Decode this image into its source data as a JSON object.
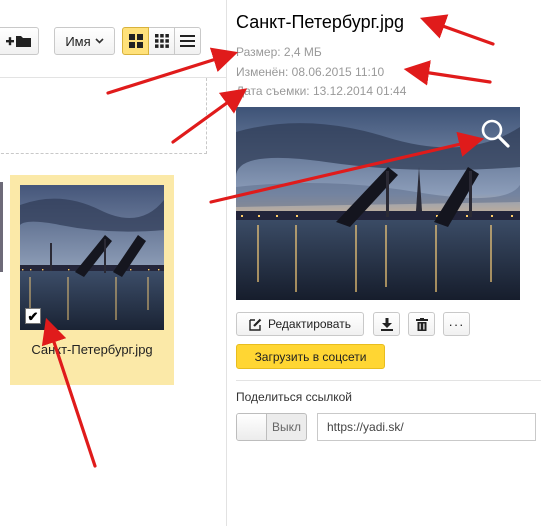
{
  "toolbar": {
    "new_folder_icon": "plus-folder-icon",
    "sort_label": "Имя",
    "views": [
      {
        "name": "tiles-large",
        "icon": "large-grid-icon",
        "active": true
      },
      {
        "name": "tiles-small",
        "icon": "small-grid-icon",
        "active": false
      },
      {
        "name": "list",
        "icon": "list-icon",
        "active": false
      }
    ]
  },
  "file_tile": {
    "name": "Санкт-Петербург.jpg",
    "checked": true,
    "check_mark": "✔"
  },
  "info_panel": {
    "title": "Санкт-Петербург.jpg",
    "size": "Размер: 2,4 МБ",
    "modified": "Изменён: 08.06.2015 11:10",
    "date_taken": "Дата съемки: 13.12.2014 01:44",
    "edit_label": "Редактировать",
    "more_label": "···",
    "social_upload_label": "Загрузить в соцсети",
    "share_label": "Поделиться ссылкой",
    "share_toggle_state": "Выкл",
    "share_link": "https://yadi.sk/"
  },
  "colors": {
    "accent_yellow": "#ffd633",
    "selected_tile": "#fbe9a8",
    "annotation_red": "#e01b1b",
    "meta_gray": "#999999"
  }
}
